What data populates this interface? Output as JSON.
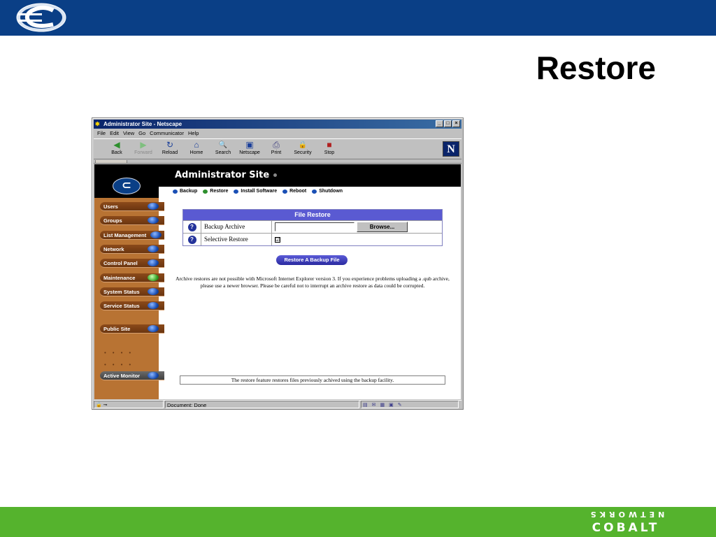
{
  "slide": {
    "title": "Restore",
    "bottom_brand": "COBALT",
    "bottom_brand_sub": "NETWORKS"
  },
  "window": {
    "title": "Administrator Site - Netscape",
    "controls": [
      "_",
      "□",
      "×"
    ],
    "menu": [
      "File",
      "Edit",
      "View",
      "Go",
      "Communicator",
      "Help"
    ],
    "toolbar": [
      {
        "label": "Back",
        "icon": "back-icon",
        "glyph": "◀"
      },
      {
        "label": "Forward",
        "icon": "forward-icon",
        "glyph": "▶"
      },
      {
        "label": "Reload",
        "icon": "reload-icon",
        "glyph": "↻"
      },
      {
        "label": "Home",
        "icon": "home-icon",
        "glyph": "⌂"
      },
      {
        "label": "Search",
        "icon": "search-icon",
        "glyph": "🔍"
      },
      {
        "label": "Netscape",
        "icon": "netscape-icon",
        "glyph": "▣"
      },
      {
        "label": "Print",
        "icon": "print-icon",
        "glyph": "⎙"
      },
      {
        "label": "Security",
        "icon": "security-icon",
        "glyph": "🔒"
      },
      {
        "label": "Stop",
        "icon": "stop-icon",
        "glyph": "■"
      }
    ],
    "logo_letter": "N"
  },
  "page": {
    "site_title": "Administrator Site",
    "sidebar": [
      {
        "label": "Users",
        "dot": "blue"
      },
      {
        "label": "Groups",
        "dot": "blue"
      },
      {
        "label": "List Management",
        "dot": "blue"
      },
      {
        "label": "Network",
        "dot": "blue"
      },
      {
        "label": "Control Panel",
        "dot": "blue"
      },
      {
        "label": "Maintenance",
        "dot": "green"
      },
      {
        "label": "System Status",
        "dot": "blue"
      },
      {
        "label": "Service Status",
        "dot": "blue"
      },
      {
        "label": "Public Site",
        "dot": "blue"
      },
      {
        "label": "Active Monitor",
        "dot": "blue"
      }
    ],
    "subnav": [
      {
        "label": "Backup",
        "dot": "blue"
      },
      {
        "label": "Restore",
        "dot": "green"
      },
      {
        "label": "Install Software",
        "dot": "blue"
      },
      {
        "label": "Reboot",
        "dot": "blue"
      },
      {
        "label": "Shutdown",
        "dot": "blue"
      }
    ],
    "file_restore": {
      "header": "File Restore",
      "rows": [
        {
          "label": "Backup Archive",
          "input_value": "",
          "button": "Browse..."
        },
        {
          "label": "Selective Restore",
          "checked": "☑"
        }
      ]
    },
    "restore_button": "Restore A Backup File",
    "note": "Archive restores are not possible with Microsoft Internet Explorer version 3. If you experience problems uploading a .qub archive, please use a newer browser. Please be careful not to interrupt an archive restore as data could be corrupted.",
    "footer": "The restore feature restores files previously achived using the backup facility."
  },
  "status": {
    "document": "Document: Done"
  },
  "colors": {
    "slide_top": "#0a3f86",
    "slide_bottom": "#55b32d",
    "sidebar": "#b87333",
    "table_header": "#5a5ad2"
  }
}
